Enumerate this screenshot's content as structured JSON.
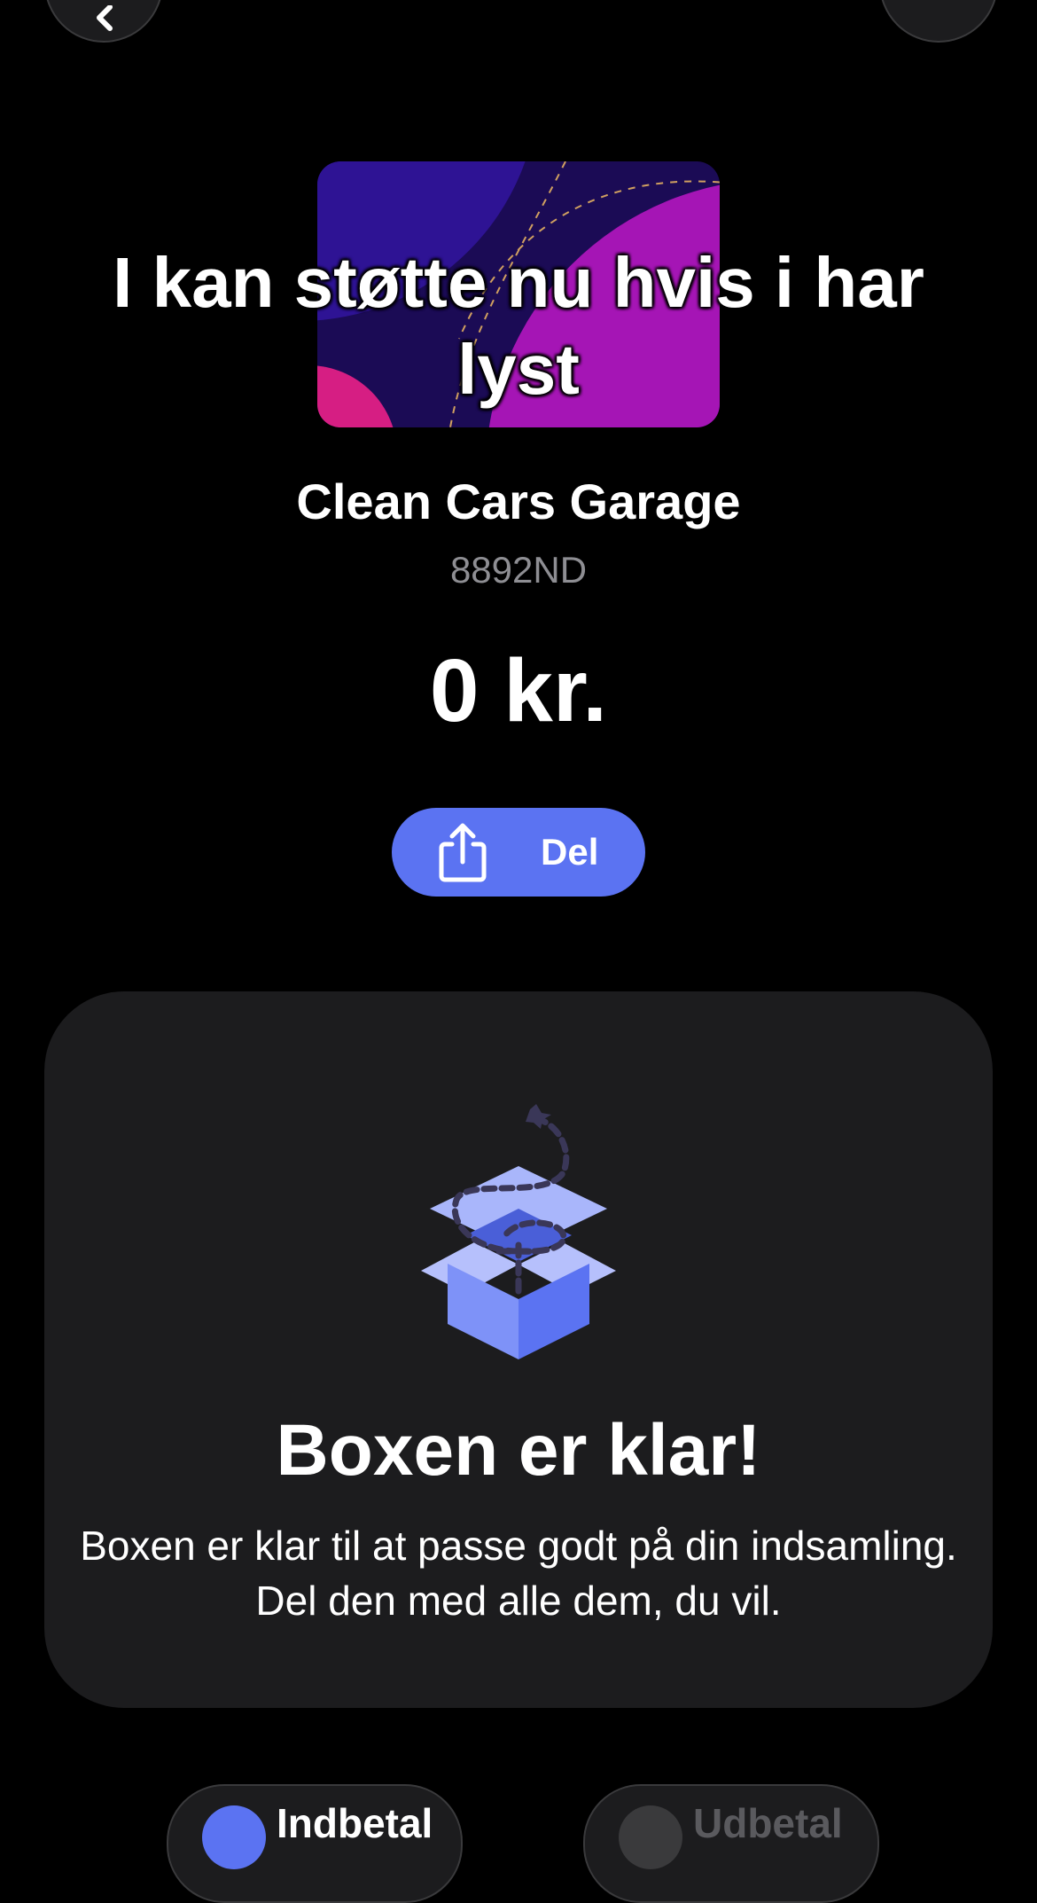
{
  "header": {
    "back_icon": "chevron-left-icon",
    "more_icon": "more-icon"
  },
  "overlay_caption": "I kan støtte nu hvis i har lyst",
  "collection": {
    "name": "Clean Cars Garage",
    "code": "8892ND",
    "amount": "0 kr."
  },
  "share_button": {
    "label": "Del",
    "icon": "share-icon"
  },
  "empty_state": {
    "icon": "open-box-icon",
    "title": "Boxen er klar!",
    "text": "Boxen er klar til at passe godt på din indsamling. Del den med alle dem, du vil."
  },
  "bottom_actions": {
    "deposit_label": "Indbetal",
    "withdraw_label": "Udbetal"
  },
  "colors": {
    "background": "#000000",
    "card": "#1c1c1e",
    "accent": "#5b73f2",
    "muted_text": "#8e8e93"
  }
}
